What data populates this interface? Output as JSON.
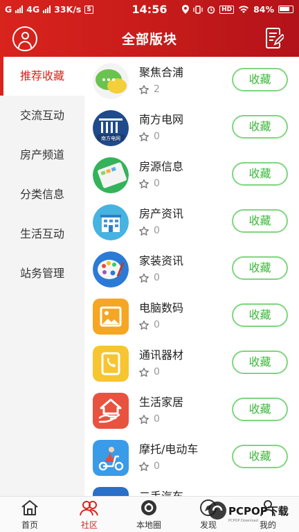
{
  "status_bar": {
    "carrier_left": "G",
    "network": "4G",
    "speed": "33K/s",
    "sim_badge": "S",
    "time": "14:56",
    "hd": "HD",
    "battery": "84%"
  },
  "header": {
    "title": "全部版块",
    "left_icon": "user-icon",
    "right_icon": "edit-icon"
  },
  "sidebar": {
    "items": [
      {
        "label": "推荐收藏",
        "active": true
      },
      {
        "label": "交流互动",
        "active": false
      },
      {
        "label": "房产频道",
        "active": false
      },
      {
        "label": "分类信息",
        "active": false
      },
      {
        "label": "生活互动",
        "active": false
      },
      {
        "label": "站务管理",
        "active": false
      }
    ]
  },
  "list": {
    "items": [
      {
        "name": "聚焦合浦",
        "count": "2",
        "button": "收藏",
        "icon": "chat-bubbles-icon"
      },
      {
        "name": "南方电网",
        "count": "0",
        "button": "收藏",
        "icon": "southern-grid-logo-icon"
      },
      {
        "name": "房源信息",
        "count": "0",
        "button": "收藏",
        "icon": "tablet-icon"
      },
      {
        "name": "房产资讯",
        "count": "0",
        "button": "收藏",
        "icon": "building-icon"
      },
      {
        "name": "家装资讯",
        "count": "0",
        "button": "收藏",
        "icon": "palette-icon"
      },
      {
        "name": "电脑数码",
        "count": "0",
        "button": "收藏",
        "icon": "picture-icon"
      },
      {
        "name": "通讯器材",
        "count": "0",
        "button": "收藏",
        "icon": "phone-book-icon"
      },
      {
        "name": "生活家居",
        "count": "0",
        "button": "收藏",
        "icon": "home-hand-icon"
      },
      {
        "name": "摩托/电动车",
        "count": "0",
        "button": "收藏",
        "icon": "scooter-icon"
      },
      {
        "name": "二手汽车",
        "count": "",
        "button": "",
        "icon": "car-icon"
      }
    ],
    "logo_text": "南方电网"
  },
  "tabbar": {
    "tabs": [
      {
        "label": "首页",
        "icon": "home-icon"
      },
      {
        "label": "社区",
        "icon": "community-icon",
        "active": true
      },
      {
        "label": "本地圈",
        "icon": "local-circle-icon"
      },
      {
        "label": "发现",
        "icon": "discover-icon"
      },
      {
        "label": "我的",
        "icon": "profile-icon"
      }
    ]
  },
  "watermark": {
    "text": "PCPOP下载",
    "sub": "PCPOP Download"
  },
  "colors": {
    "primary": "#d9231d",
    "accent_green": "#3cb83c",
    "sidebar_bg": "#f4f4f4"
  }
}
